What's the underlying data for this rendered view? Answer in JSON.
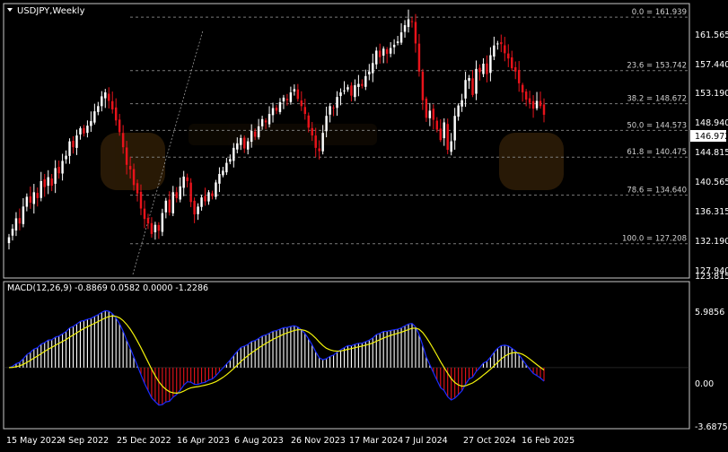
{
  "window": {
    "symbol_title": "USDJPY,Weekly"
  },
  "price_axis": {
    "ticks": [
      "161.565",
      "157.440",
      "153.190",
      "148.940",
      "144.815",
      "140.565",
      "136.315",
      "132.190",
      "127.940",
      "123.815"
    ],
    "current_price": "146.972"
  },
  "fibonacci": {
    "levels": [
      {
        "label": "0.0 = 161.939"
      },
      {
        "label": "23.6 = 153.742"
      },
      {
        "label": "38.2 = 148.672"
      },
      {
        "label": "50.0 = 144.573"
      },
      {
        "label": "61.8 = 140.475"
      },
      {
        "label": "78.6 = 134.640"
      },
      {
        "label": "100.0 = 127.208"
      }
    ]
  },
  "macd_panel": {
    "label": "MACD(12,26,9) -0.8869 0.0582 0.0000 -1.2286",
    "ticks": [
      "5.9856",
      "0.00",
      "-3.6875"
    ]
  },
  "time_axis": {
    "labels": [
      "15 May 2022",
      "4 Sep 2022",
      "25 Dec 2022",
      "16 Apr 2023",
      "6 Aug 2023",
      "26 Nov 2023",
      "17 Mar 2024",
      "7 Jul 2024",
      "27 Oct 2024",
      "16 Feb 2025"
    ]
  },
  "colors": {
    "bull": "#ffffff",
    "bear": "#e8131b",
    "grid": "#7a7a7a",
    "macd_line": "#1a2cff",
    "signal_line": "#f2f20a"
  },
  "chart_data": {
    "type": "candlestick",
    "timeframe": "Weekly",
    "symbol": "USDJPY",
    "current_price": 146.972,
    "candles_close": [
      128.2,
      129.5,
      131.1,
      130.3,
      132.9,
      134.4,
      133.5,
      135.1,
      134.2,
      136.8,
      135.9,
      137.4,
      136.1,
      138.8,
      138.0,
      139.9,
      140.7,
      142.9,
      142.0,
      143.8,
      144.9,
      144.1,
      145.3,
      146.0,
      147.5,
      148.3,
      149.8,
      150.4,
      149.1,
      147.8,
      146.1,
      144.3,
      142.0,
      139.3,
      138.6,
      136.2,
      134.9,
      132.6,
      131.0,
      130.3,
      128.7,
      130.1,
      129.2,
      131.9,
      133.8,
      132.0,
      135.1,
      134.2,
      136.0,
      137.5,
      136.8,
      133.6,
      131.7,
      132.9,
      134.3,
      133.7,
      135.1,
      134.5,
      136.6,
      137.9,
      138.4,
      139.6,
      140.2,
      141.9,
      142.6,
      143.4,
      141.8,
      142.9,
      144.5,
      143.6,
      145.2,
      146.3,
      145.8,
      147.1,
      148.0,
      147.6,
      148.9,
      149.6,
      149.2,
      150.4,
      150.9,
      149.4,
      148.3,
      147.1,
      145.0,
      143.8,
      141.9,
      141.4,
      144.2,
      146.8,
      148.3,
      148.0,
      149.7,
      150.4,
      150.7,
      151.2,
      149.9,
      151.5,
      151.7,
      151.4,
      152.9,
      153.6,
      154.9,
      156.8,
      155.8,
      157.1,
      156.3,
      157.2,
      157.7,
      158.2,
      159.6,
      160.7,
      161.6,
      161.2,
      157.9,
      153.6,
      149.2,
      146.5,
      147.6,
      146.2,
      144.7,
      143.1,
      145.8,
      141.6,
      142.9,
      146.8,
      148.4,
      149.2,
      152.3,
      152.6,
      150.0,
      154.0,
      153.5,
      154.8,
      153.2,
      156.1,
      157.6,
      157.9,
      157.8,
      156.4,
      155.6,
      154.1,
      153.6,
      151.8,
      150.4,
      149.3,
      148.8,
      147.9,
      149.1,
      148.3,
      146.972
    ],
    "fibonacci_retracement": [
      {
        "level": 0.0,
        "price": 161.939
      },
      {
        "level": 23.6,
        "price": 153.742
      },
      {
        "level": 38.2,
        "price": 148.672
      },
      {
        "level": 50.0,
        "price": 144.573
      },
      {
        "level": 61.8,
        "price": 140.475
      },
      {
        "level": 78.6,
        "price": 134.64
      },
      {
        "level": 100.0,
        "price": 127.208
      }
    ],
    "price_ylim": [
      122.5,
      163.6
    ],
    "macd": {
      "fast": 12,
      "slow": 26,
      "signal": 9,
      "values": [
        -0.8869,
        0.0582,
        0.0,
        -1.2286
      ],
      "ylim": [
        -4.6,
        6.4
      ]
    }
  }
}
